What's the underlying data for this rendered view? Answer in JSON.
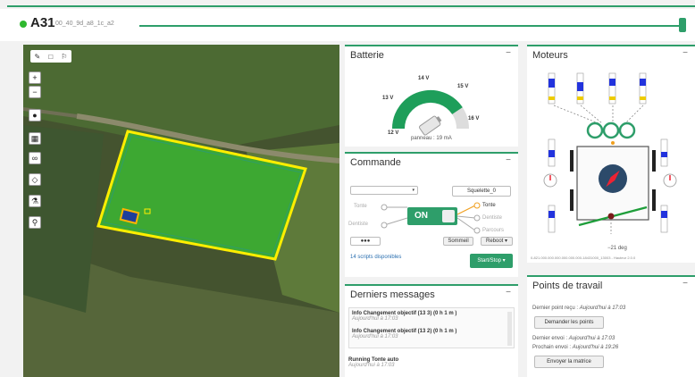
{
  "header": {
    "robot_name": "A31",
    "robot_id": "00_40_9d_a8_1c_a2",
    "status_color": "#2eb82e"
  },
  "map": {
    "toolbar_top": [
      "✎",
      "□",
      "⚐"
    ],
    "controls": [
      "+",
      "−",
      "●",
      "▦",
      "∞",
      "◇",
      "⚗",
      "⚲"
    ]
  },
  "battery": {
    "title": "Batterie",
    "minimize": "−",
    "scale": [
      "12 V",
      "13 V",
      "14 V",
      "15 V",
      "16 V"
    ],
    "panel_current": "panneau : 19 mA"
  },
  "commande": {
    "title": "Commande",
    "minimize": "−",
    "skeleton": "Squelette_0",
    "mode_left": [
      "Tonte",
      "Dentiste"
    ],
    "mode_right": [
      "Tonte",
      "Dentiste",
      "Parcours"
    ],
    "switch_label": "ON",
    "dots_select": "●●●",
    "btn_sommeil": "Sommeil",
    "btn_reboot": "Reboot ▾",
    "scripts_link": "14 scripts disponibles",
    "start_stop": "Start/Stop ▾"
  },
  "moteurs": {
    "title": "Moteurs",
    "minimize": "−",
    "angle": "−21 deg",
    "footer": "0-821.000.000.000.000.000.000-18431000_13003 - Hauteur 2.0.0"
  },
  "messages": {
    "title": "Derniers messages",
    "minimize": "−",
    "items": [
      {
        "title": "Info Changement objectif (13 3) (0 h 1 m )",
        "time": "Aujourd'hui à 17:03"
      },
      {
        "title": "Info Changement objectif (13 2) (0 h 1 m )",
        "time": "Aujourd'hui à 17:03"
      },
      {
        "title": "Running Tonte auto",
        "time": "Aujourd'hui à 17:03"
      }
    ]
  },
  "points": {
    "title": "Points de travail",
    "minimize": "−",
    "last_received_label": "Dernier point reçu : ",
    "last_received_time": "Aujourd'hui à 17:03",
    "btn_request": "Demander les points",
    "last_sent_label": "Dernier envoi : ",
    "last_sent_time": "Aujourd'hui à 17:03",
    "next_sent_label": "Prochain envoi : ",
    "next_sent_time": "Aujourd'hui à 19:26",
    "btn_send": "Envoyer la matrice"
  },
  "colors": {
    "accent": "#2e9e6a",
    "field": "#3da832",
    "field_border": "#ffee00",
    "link": "#2a6fb0"
  }
}
